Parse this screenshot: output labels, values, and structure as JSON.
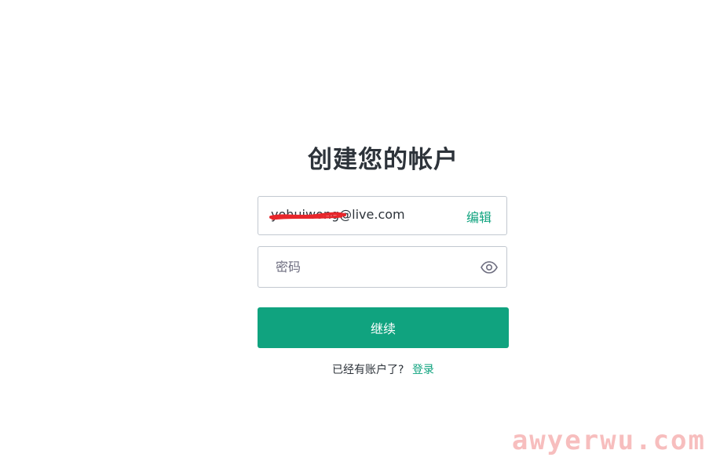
{
  "page": {
    "title": "创建您的帐户"
  },
  "email": {
    "value": "yohuiwong@live.com",
    "edit_label": "编辑"
  },
  "password": {
    "placeholder": "密码",
    "toggle_icon": "eye-icon"
  },
  "actions": {
    "continue_label": "继续"
  },
  "footer": {
    "prompt": "已经有账户了?",
    "login_label": "登录"
  },
  "watermark": {
    "text": "awyerwu.com"
  },
  "colors": {
    "accent": "#10a37f",
    "border": "#c2c8d0",
    "text": "#2d333a",
    "redaction": "#e8262b"
  }
}
